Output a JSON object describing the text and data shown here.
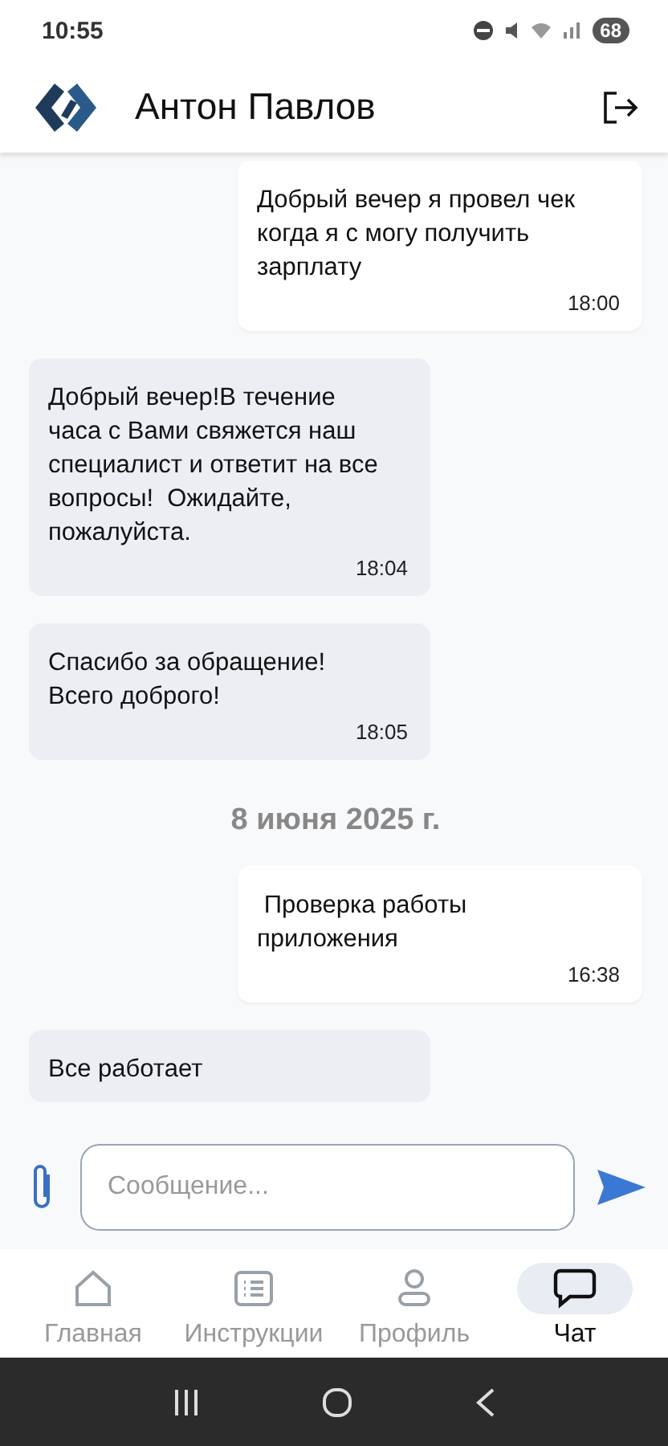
{
  "status_bar": {
    "time": "10:55",
    "battery": "68"
  },
  "header": {
    "title": "Антон Павлов"
  },
  "messages": [
    {
      "kind": "message",
      "outgoing": true,
      "text": "Добрый вечер я провел чек когда я с могу получить зарплату",
      "time": "18:00"
    },
    {
      "kind": "message",
      "outgoing": false,
      "text": "Добрый вечер!В течение часа с Вами свяжется наш специалист и ответит на все вопросы!  Ожидайте, пожалуйста.",
      "time": "18:04"
    },
    {
      "kind": "message",
      "outgoing": false,
      "text": "Спасибо за обращение! Всего доброго!",
      "time": "18:05"
    },
    {
      "kind": "date",
      "text": "8 июня 2025 г."
    },
    {
      "kind": "message",
      "outgoing": true,
      "text": " Проверка работы приложения",
      "time": "16:38"
    },
    {
      "kind": "message",
      "outgoing": false,
      "text": "Все работает"
    }
  ],
  "composer": {
    "placeholder": "Сообщение..."
  },
  "nav": [
    {
      "kind": "home",
      "label": "Главная",
      "selected": false
    },
    {
      "kind": "list",
      "label": "Инструкции",
      "selected": false
    },
    {
      "kind": "profile",
      "label": "Профиль",
      "selected": false
    },
    {
      "kind": "chat",
      "label": "Чат",
      "selected": true
    }
  ]
}
